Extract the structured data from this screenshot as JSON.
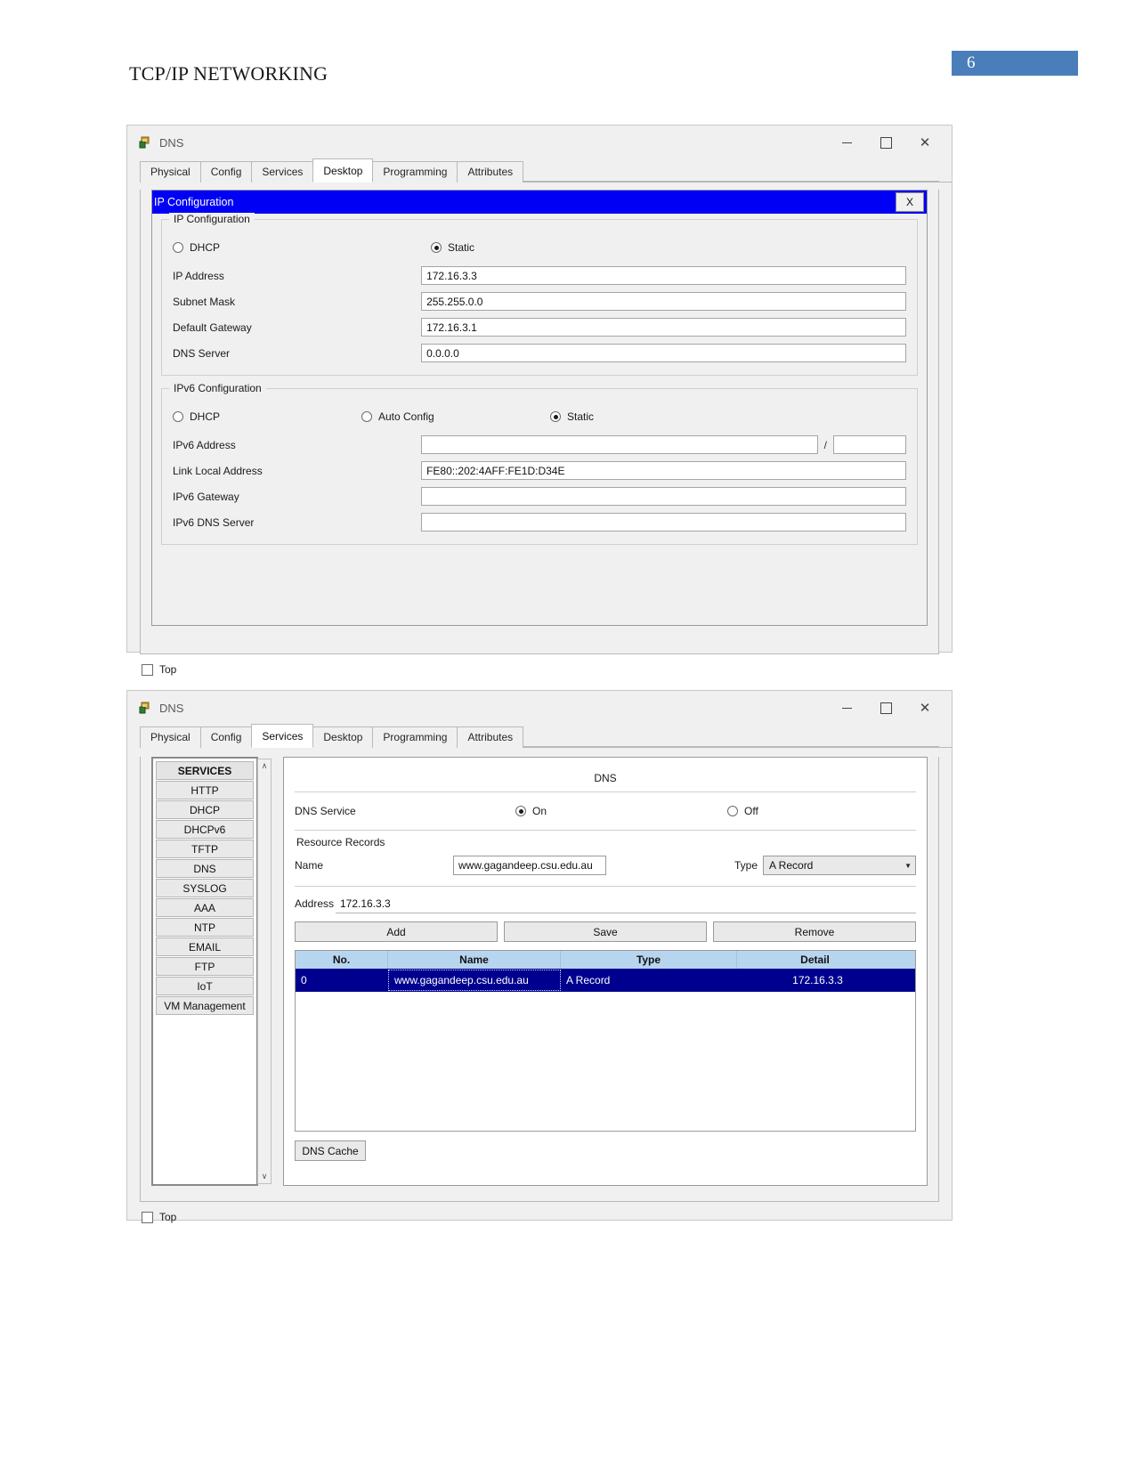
{
  "document": {
    "title": "TCP/IP NETWORKING",
    "page_number": "6",
    "badge_color": "#4a7ebb"
  },
  "window_ipconfig": {
    "titlebar": {
      "title": "DNS",
      "icon": "packet-tracer-icon",
      "minimize": "–",
      "maximize": "❐",
      "close": "✕"
    },
    "tabs": [
      {
        "label": "Physical",
        "active": false
      },
      {
        "label": "Config",
        "active": false
      },
      {
        "label": "Services",
        "active": false
      },
      {
        "label": "Desktop",
        "active": true
      },
      {
        "label": "Programming",
        "active": false
      },
      {
        "label": "Attributes",
        "active": false
      }
    ],
    "panel": {
      "title": "IP Configuration",
      "close_label": "X",
      "title_bg": "#0000f5"
    },
    "ipv4": {
      "legend": "IP Configuration",
      "mode_dhcp": "DHCP",
      "mode_static": "Static",
      "selected_mode": "Static",
      "fields": [
        {
          "label": "IP Address",
          "value": "172.16.3.3"
        },
        {
          "label": "Subnet Mask",
          "value": "255.255.0.0"
        },
        {
          "label": "Default Gateway",
          "value": "172.16.3.1"
        },
        {
          "label": "DNS Server",
          "value": "0.0.0.0"
        }
      ]
    },
    "ipv6": {
      "legend": "IPv6 Configuration",
      "mode_dhcp": "DHCP",
      "mode_auto": "Auto Config",
      "mode_static": "Static",
      "selected_mode": "Static",
      "address_label": "IPv6 Address",
      "address_value": "",
      "prefix_value": "",
      "prefix_separator": "/",
      "fields": [
        {
          "label": "Link Local Address",
          "value": "FE80::202:4AFF:FE1D:D34E"
        },
        {
          "label": "IPv6 Gateway",
          "value": ""
        },
        {
          "label": "IPv6 DNS Server",
          "value": ""
        }
      ]
    },
    "footer": {
      "top_label": "Top",
      "top_checked": false
    }
  },
  "window_dns": {
    "titlebar": {
      "title": "DNS",
      "icon": "packet-tracer-icon",
      "minimize": "–",
      "maximize": "❐",
      "close": "✕"
    },
    "tabs": [
      {
        "label": "Physical",
        "active": false
      },
      {
        "label": "Config",
        "active": false
      },
      {
        "label": "Services",
        "active": true
      },
      {
        "label": "Desktop",
        "active": false
      },
      {
        "label": "Programming",
        "active": false
      },
      {
        "label": "Attributes",
        "active": false
      }
    ],
    "services": [
      {
        "label": "SERVICES",
        "header": true
      },
      {
        "label": "HTTP",
        "header": false
      },
      {
        "label": "DHCP",
        "header": false
      },
      {
        "label": "DHCPv6",
        "header": false
      },
      {
        "label": "TFTP",
        "header": false
      },
      {
        "label": "DNS",
        "header": false
      },
      {
        "label": "SYSLOG",
        "header": false
      },
      {
        "label": "AAA",
        "header": false
      },
      {
        "label": "NTP",
        "header": false
      },
      {
        "label": "EMAIL",
        "header": false
      },
      {
        "label": "FTP",
        "header": false
      },
      {
        "label": "IoT",
        "header": false
      },
      {
        "label": "VM Management",
        "header": false
      }
    ],
    "scrollbar": {
      "up": "∧",
      "down": "∨"
    },
    "pane": {
      "heading": "DNS",
      "service_label": "DNS Service",
      "on_label": "On",
      "off_label": "Off",
      "service_state": "On",
      "resource_records_label": "Resource Records",
      "name_label": "Name",
      "name_value": "www.gagandeep.csu.edu.au",
      "type_label": "Type",
      "type_value": "A Record",
      "type_caret": "▼",
      "address_label": "Address",
      "address_value": "172.16.3.3",
      "buttons": {
        "add": "Add",
        "save": "Save",
        "remove": "Remove"
      },
      "table": {
        "columns": [
          "No.",
          "Name",
          "Type",
          "Detail"
        ],
        "rows": [
          {
            "no": "0",
            "name": "www.gagandeep.csu.edu.au",
            "type": "A Record",
            "detail": "172.16.3.3",
            "selected": true
          }
        ],
        "header_bg": "#b8d5ef",
        "selected_bg": "#00008f"
      },
      "cache_button": "DNS Cache"
    },
    "footer": {
      "top_label": "Top",
      "top_checked": false
    }
  }
}
